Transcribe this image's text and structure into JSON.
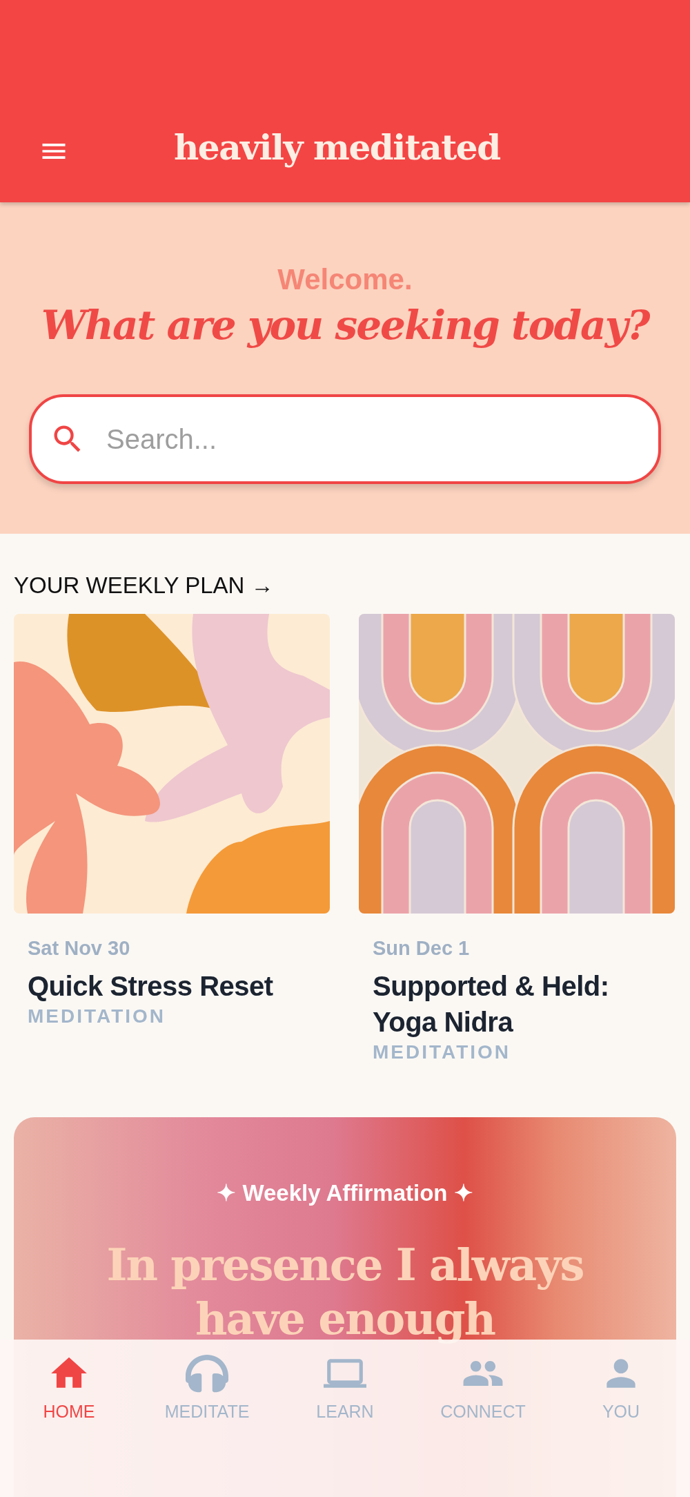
{
  "header": {
    "title": "heavily meditated"
  },
  "welcome": {
    "greeting": "Welcome.",
    "question": "What are you seeking today?"
  },
  "search": {
    "placeholder": "Search..."
  },
  "weekly_plan": {
    "heading": "YOUR WEEKLY PLAN →",
    "items": [
      {
        "date": "Sat Nov 30",
        "title": "Quick Stress Reset",
        "category": "MEDITATION"
      },
      {
        "date": "Sun Dec 1",
        "title": "Supported & Held: Yoga Nidra",
        "category": "MEDITATION"
      }
    ]
  },
  "affirmation": {
    "label": "✦ Weekly Affirmation ✦",
    "text": "In presence I always have enough"
  },
  "nav": [
    {
      "label": "HOME",
      "selected": true
    },
    {
      "label": "MEDITATE",
      "selected": false
    },
    {
      "label": "LEARN",
      "selected": false
    },
    {
      "label": "CONNECT",
      "selected": false
    },
    {
      "label": "YOU",
      "selected": false
    }
  ]
}
